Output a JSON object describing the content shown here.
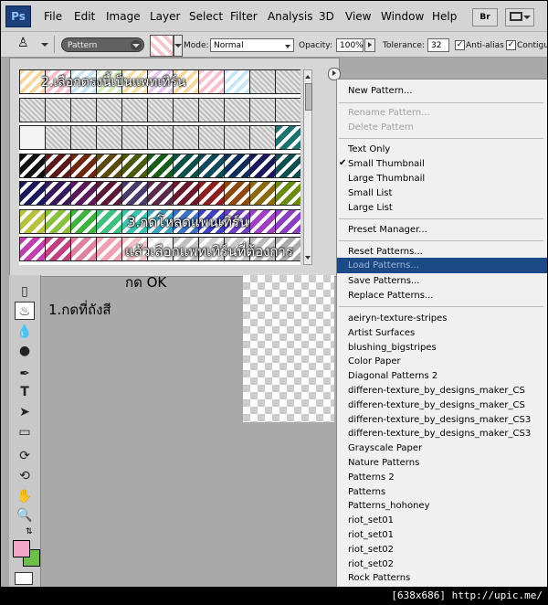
{
  "menubar": {
    "logo": "Ps",
    "items": [
      "File",
      "Edit",
      "Image",
      "Layer",
      "Select",
      "Filter",
      "Analysis",
      "3D",
      "View",
      "Window",
      "Help"
    ],
    "bridge_button": "Br"
  },
  "options": {
    "fill_source": "Pattern",
    "mode_label": "Mode:",
    "mode_value": "Normal",
    "opacity_label": "Opacity:",
    "opacity_value": "100%",
    "tolerance_label": "Tolerance:",
    "tolerance_value": "32",
    "antialias_label": "Anti-alias",
    "contiguous_label": "Contigu"
  },
  "annotations": {
    "step2": "2.เลือกตรงนี้เป็นแพทเทิร์น",
    "step3a": "3.กดโหลดแพนเทิร์น",
    "step3b": "แล้วเลือกแพทเทิร์นที่ต้องการ",
    "ok": "กด OK",
    "step1": "1.กดที่ถังสี"
  },
  "menu": {
    "new_pattern": "New Pattern...",
    "rename_pattern": "Rename Pattern...",
    "delete_pattern": "Delete Pattern",
    "text_only": "Text Only",
    "small_thumbnail": "Small Thumbnail",
    "large_thumbnail": "Large Thumbnail",
    "small_list": "Small List",
    "large_list": "Large List",
    "preset_manager": "Preset Manager...",
    "reset_patterns": "Reset Patterns...",
    "load_patterns": "Load Patterns...",
    "save_patterns": "Save Patterns...",
    "replace_patterns": "Replace Patterns...",
    "libraries": [
      "aeiryn-texture-stripes",
      "Artist Surfaces",
      "blushing_bigstripes",
      "Color Paper",
      "Diagonal Patterns 2",
      "differen-texture_by_designs_maker_CS",
      "differen-texture_by_designs_maker_CS",
      "differen-texture_by_designs_maker_CS3",
      "differen-texture_by_designs_maker_CS3",
      "Grayscale Paper",
      "Nature Patterns",
      "Patterns 2",
      "Patterns",
      "Patterns_hohoney",
      "riot_set01",
      "riot_set01",
      "riot_set02",
      "riot_set02",
      "Rock Patterns"
    ]
  },
  "footer": "[638x686] http://upic.me/",
  "colors": {
    "foreground": "#f4a6c6",
    "background": "#6cc04a",
    "highlight": "#1c4a86"
  }
}
